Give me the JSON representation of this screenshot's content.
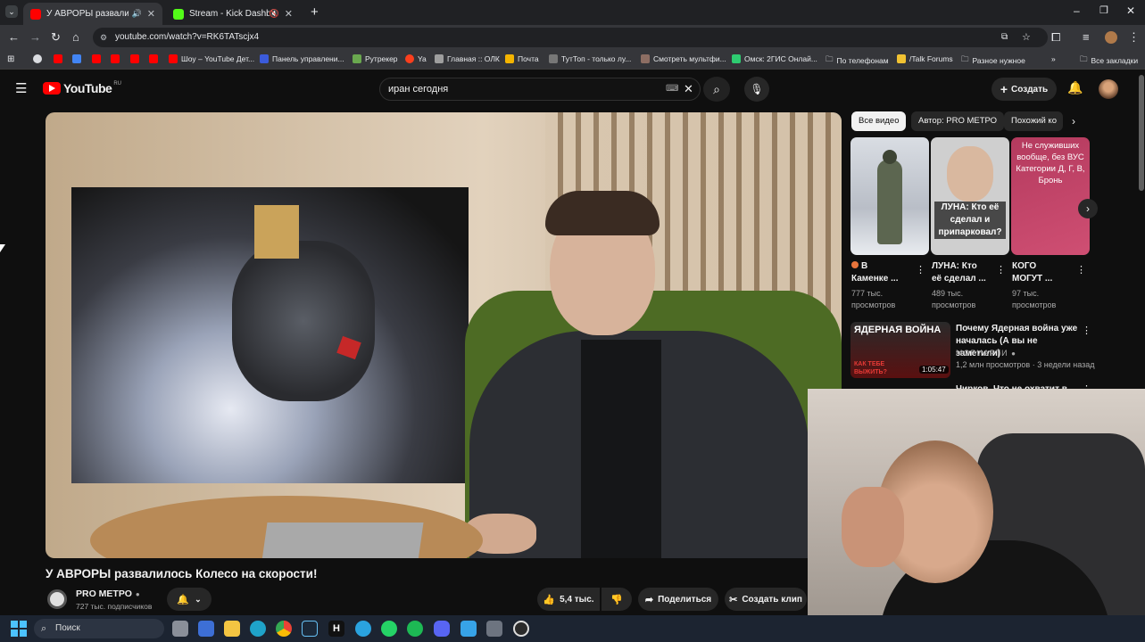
{
  "browser": {
    "tabs": [
      {
        "title": "У АВРОРЫ развалилось К",
        "active": true
      },
      {
        "title": "Stream - Kick Dashboard",
        "active": false
      }
    ],
    "url": "youtube.com/watch?v=RK6TATscjx4",
    "bookmarks": [
      "Шоу – YouTube Дет...",
      "Панель управлени...",
      "Рутрекер",
      "Ya",
      "Главная :: ОЛК",
      "Почта",
      "ТутТоп - только лу...",
      "Смотреть мультфи...",
      "Омск: 2ГИС Онлай...",
      "По телефонам",
      "/Talk Forums",
      "Разное нужное",
      "Все закладки"
    ]
  },
  "youtube": {
    "logo": "YouTube",
    "region": "RU",
    "search_value": "иран сегодня",
    "create_label": "Создать"
  },
  "video": {
    "title": "У АВРОРЫ развалилось Колесо на скорости!",
    "channel": "PRO МЕТРО",
    "subscribers": "727 тыс. подписчиков",
    "likes": "5,4 тыс.",
    "share_label": "Поделиться",
    "clip_label": "Создать клип"
  },
  "sidebar": {
    "chips": [
      "Все видео",
      "Автор: PRO МЕТРО",
      "Похожий ко"
    ],
    "shorts": [
      {
        "title_line1": "В",
        "title_line2": "Каменке ...",
        "views1": "777 тыс.",
        "views2": "просмотров",
        "thumb_text": ""
      },
      {
        "title_line1": "ЛУНА: Кто",
        "title_line2": "её сделал ...",
        "views1": "489 тыс.",
        "views2": "просмотров",
        "thumb_text": "ЛУНА: Кто её сделал и припарковал?"
      },
      {
        "title_line1": "КОГО",
        "title_line2": "МОГУТ ...",
        "views1": "97 тыс.",
        "views2": "просмотров",
        "thumb_text": "Не служивших вообще, без ВУС Категории Д, Г, В, Бронь"
      }
    ],
    "video": {
      "title_line1": "Почему Ядерная война уже",
      "title_line2": "началась (А вы не заметили)",
      "channel": "МОРИАРТИ",
      "meta": "1,2 млн просмотров · 3 недели назад",
      "duration": "1:05:47",
      "thumb_text": "ЯДЕРНАЯ ВОЙНА",
      "thumb_sub": "КАК ТЕБЕ ВЫЖИТЬ?"
    },
    "next_partial": "Чирков. Что не охватит в"
  },
  "taskbar": {
    "search_label": "Поиск"
  }
}
